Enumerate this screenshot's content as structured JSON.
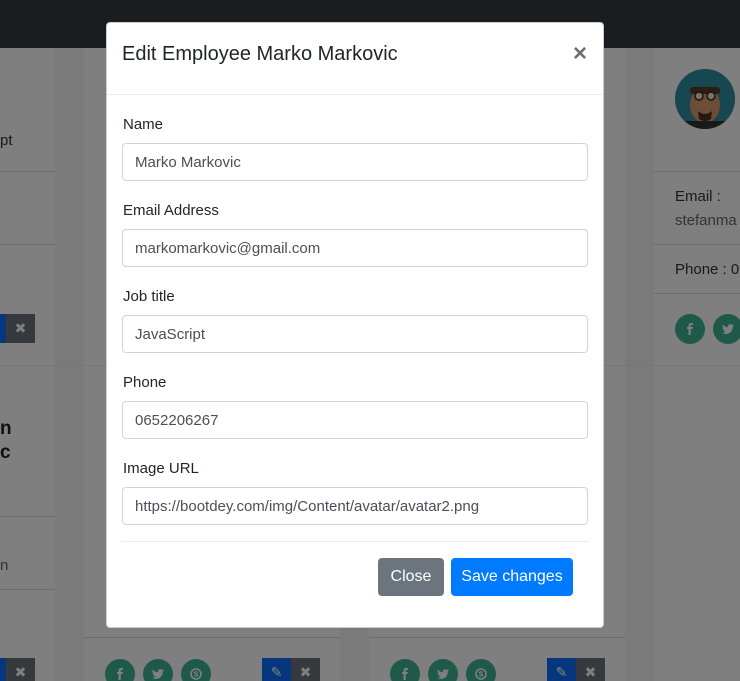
{
  "modal": {
    "title": "Edit Employee Marko Markovic",
    "close_glyph": "×",
    "fields": [
      {
        "label": "Name",
        "value": "Marko Markovic"
      },
      {
        "label": "Email Address",
        "value": "markomarkovic@gmail.com"
      },
      {
        "label": "Job title",
        "value": "JavaScript"
      },
      {
        "label": "Phone",
        "value": "0652206267"
      },
      {
        "label": "Image URL",
        "value": "https://bootdey.com/img/Content/avatar/avatar2.png"
      }
    ],
    "buttons": {
      "close": "Close",
      "save": "Save changes"
    }
  },
  "background": {
    "left_card": {
      "job_fragment": "pt",
      "name_line1": "n",
      "name_line2": "c",
      "email_fragment": "n"
    },
    "right_card": {
      "email_label": "Email :",
      "email_fragment": "stefanma",
      "phone_label": "Phone : 0"
    }
  },
  "colors": {
    "navbar": "#343a40",
    "primary": "#007bff",
    "secondary": "#6c757d",
    "social": "#3cb395"
  },
  "icons": [
    "close-icon",
    "facebook-icon",
    "twitter-icon",
    "skype-icon",
    "edit-icon",
    "delete-icon"
  ]
}
